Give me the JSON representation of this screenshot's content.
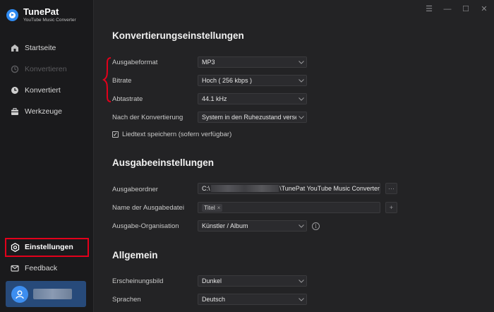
{
  "app": {
    "name": "TunePat",
    "subtitle": "YouTube Music Converter"
  },
  "sidebar": {
    "items": [
      {
        "label": "Startseite",
        "icon": "home-icon",
        "state": "normal"
      },
      {
        "label": "Konvertieren",
        "icon": "convert-icon",
        "state": "disabled"
      },
      {
        "label": "Konvertiert",
        "icon": "clock-icon",
        "state": "normal"
      },
      {
        "label": "Werkzeuge",
        "icon": "toolbox-icon",
        "state": "normal"
      },
      {
        "label": "Einstellungen",
        "icon": "gear-icon",
        "state": "active"
      },
      {
        "label": "Feedback",
        "icon": "mail-icon",
        "state": "normal"
      }
    ],
    "user": {
      "name": "",
      "icon": "user-icon"
    }
  },
  "window_controls": {
    "menu": "☰",
    "minimize": "—",
    "maximize": "☐",
    "close": "✕"
  },
  "conversion": {
    "title": "Konvertierungseinstellungen",
    "output_format_label": "Ausgabeformat",
    "output_format_value": "MP3",
    "bitrate_label": "Bitrate",
    "bitrate_value": "Hoch ( 256 kbps )",
    "samplerate_label": "Abtastrate",
    "samplerate_value": "44.1 kHz",
    "after_label": "Nach der Konvertierung",
    "after_value": "System in den Ruhezustand versetzen",
    "lyrics_label": "Liedtext speichern (sofern verfügbar)",
    "lyrics_checked": true
  },
  "output": {
    "title": "Ausgabeeinstellungen",
    "folder_label": "Ausgabeordner",
    "folder_prefix": "C:\\",
    "folder_suffix": "\\TunePat YouTube Music Converter",
    "browse_label": "···",
    "filename_label": "Name der Ausgabedatei",
    "filename_tag": "Titel",
    "filename_tag_remove": "×",
    "add_label": "+",
    "organize_label": "Ausgabe-Organisation",
    "organize_value": "Künstler  /  Album",
    "info_glyph": "i"
  },
  "general": {
    "title": "Allgemein",
    "appearance_label": "Erscheinungsbild",
    "appearance_value": "Dunkel",
    "language_label": "Sprachen",
    "language_value": "Deutsch"
  },
  "colors": {
    "accent": "#2f8bf2",
    "highlight": "#e3001b",
    "background": "#232325",
    "sidebar": "#1a1a1c",
    "user_card": "#274a7a"
  }
}
